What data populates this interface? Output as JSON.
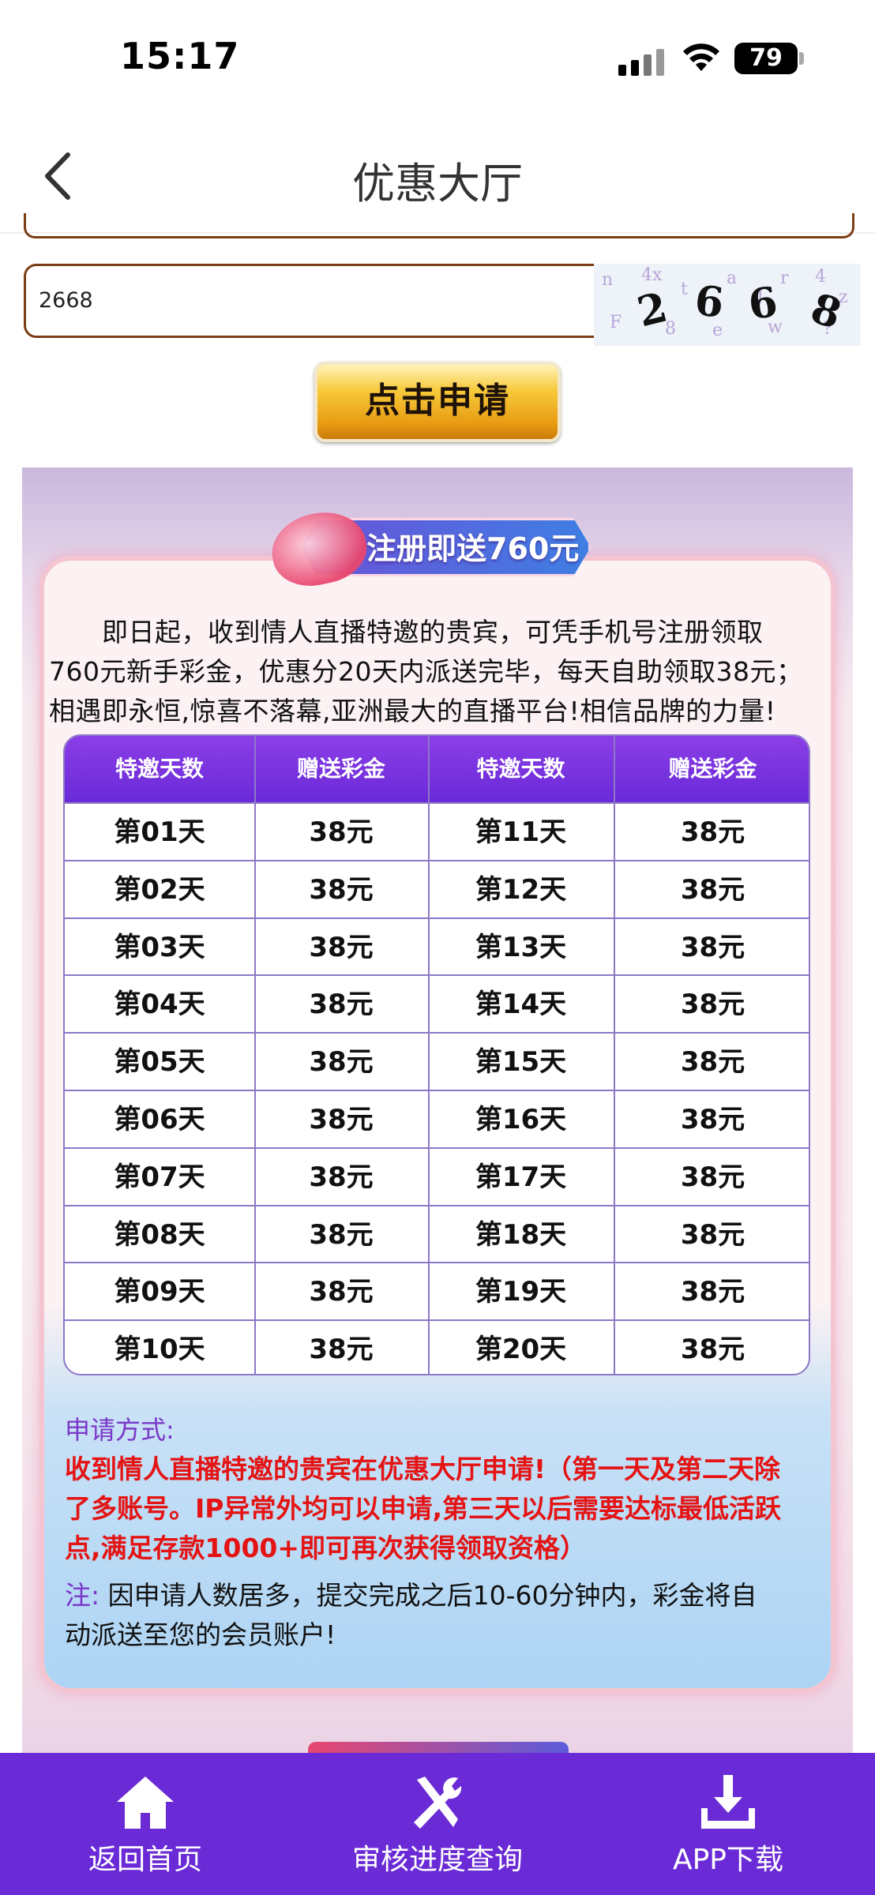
{
  "status_bar": {
    "time": "15:17",
    "battery": "79"
  },
  "nav": {
    "title": "优惠大厅"
  },
  "captcha": {
    "input_value": "2668",
    "image_text": [
      "2",
      "6",
      "6",
      "8"
    ]
  },
  "apply_button_label": "点击申请",
  "promo": {
    "ribbon_title": "注册即送760元",
    "intro_lines": [
      "　　即日起，收到情人直播特邀的贵宾，可凭手机号注册领取",
      "760元新手彩金，优惠分20天内派送完毕，每天自助领取38元；",
      "相遇即永恒,惊喜不落幕,亚洲最大的直播平台!相信品牌的力量!"
    ],
    "table": {
      "headers": [
        "特邀天数",
        "赠送彩金",
        "特邀天数",
        "赠送彩金"
      ],
      "rows": [
        [
          "第01天",
          "38元",
          "第11天",
          "38元"
        ],
        [
          "第02天",
          "38元",
          "第12天",
          "38元"
        ],
        [
          "第03天",
          "38元",
          "第13天",
          "38元"
        ],
        [
          "第04天",
          "38元",
          "第14天",
          "38元"
        ],
        [
          "第05天",
          "38元",
          "第15天",
          "38元"
        ],
        [
          "第06天",
          "38元",
          "第16天",
          "38元"
        ],
        [
          "第07天",
          "38元",
          "第17天",
          "38元"
        ],
        [
          "第08天",
          "38元",
          "第18天",
          "38元"
        ],
        [
          "第09天",
          "38元",
          "第19天",
          "38元"
        ],
        [
          "第10天",
          "38元",
          "第20天",
          "38元"
        ]
      ]
    },
    "how_to_title": "申请方式:",
    "how_to_lines": [
      "收到情人直播特邀的贵宾在优惠大厅申请!（第一天及第二天除",
      "了多账号。IP异常外均可以申请,第三天以后需要达标最低活跃",
      "点,满足存款1000+即可再次获得领取资格）"
    ],
    "note_label": "注:",
    "note_lines": [
      "因申请人数居多，提交完成之后10-60分钟内，彩金将自",
      "动派送至您的会员账户!"
    ]
  },
  "tabbar": {
    "items": [
      {
        "label": "返回首页",
        "icon": "home-icon"
      },
      {
        "label": "审核进度查询",
        "icon": "tools-icon"
      },
      {
        "label": "APP下载",
        "icon": "download-icon"
      }
    ]
  },
  "colors": {
    "tab_bar": "#6a2bd6",
    "table_header": "#7a32de",
    "highlight_red": "#e41414",
    "label_purple": "#7a37c8",
    "field_border": "#7a3d14"
  }
}
